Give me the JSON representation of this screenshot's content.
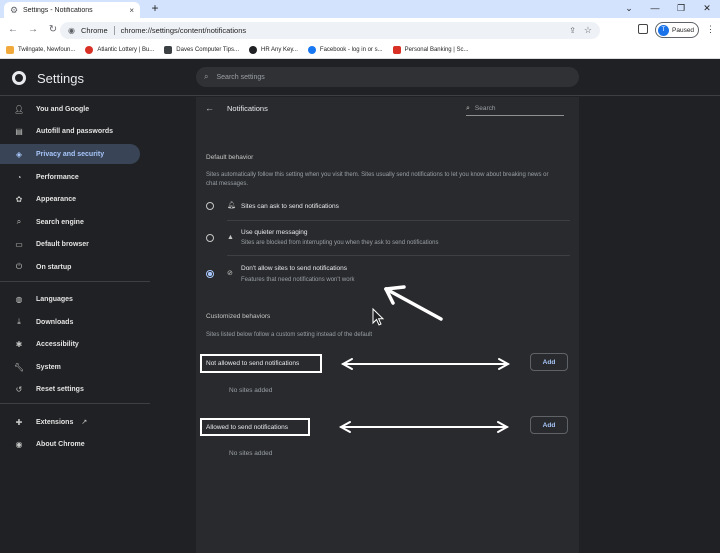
{
  "browser": {
    "tab_title": "Settings - Notifications",
    "tab_close": "×",
    "new_tab": "+",
    "window_controls": [
      "⌄",
      "—",
      "❐",
      "✕"
    ],
    "chrome_label": "Chrome",
    "url": "chrome://settings/content/notifications",
    "profile_initial": "T",
    "profile_status": "Paused",
    "bookmarks": [
      {
        "label": "Twilngate, Newfoun...",
        "color": "#f2a93b"
      },
      {
        "label": "Atlantic Lottery | Bu...",
        "color": "#d93025"
      },
      {
        "label": "Daves Computer Tips...",
        "color": "#3c4043"
      },
      {
        "label": "HR Any Key...",
        "color": "#202124"
      },
      {
        "label": "Facebook - log in or s...",
        "color": "#1877f2"
      },
      {
        "label": "Personal Banking | Sc...",
        "color": "#d93025"
      }
    ]
  },
  "settings": {
    "title": "Settings",
    "search_placeholder": "Search settings"
  },
  "sidebar": {
    "items": [
      {
        "label": "You and Google",
        "icon": "person-icon"
      },
      {
        "label": "Autofill and passwords",
        "icon": "clipboard-icon"
      },
      {
        "label": "Privacy and security",
        "icon": "shield-icon",
        "active": true
      },
      {
        "label": "Performance",
        "icon": "speedometer-icon"
      },
      {
        "label": "Appearance",
        "icon": "palette-icon"
      },
      {
        "label": "Search engine",
        "icon": "search-icon"
      },
      {
        "label": "Default browser",
        "icon": "browser-icon"
      },
      {
        "label": "On startup",
        "icon": "power-icon"
      },
      {
        "label": "Languages",
        "icon": "globe-icon"
      },
      {
        "label": "Downloads",
        "icon": "download-icon"
      },
      {
        "label": "Accessibility",
        "icon": "accessibility-icon"
      },
      {
        "label": "System",
        "icon": "wrench-icon"
      },
      {
        "label": "Reset settings",
        "icon": "reset-icon"
      },
      {
        "label": "Extensions",
        "icon": "puzzle-icon"
      },
      {
        "label": "About Chrome",
        "icon": "chrome-icon"
      }
    ]
  },
  "notifications": {
    "title": "Notifications",
    "search_placeholder": "Search",
    "default_behavior": "Default behavior",
    "default_desc": "Sites automatically follow this setting when you visit them. Sites usually send notifications to let you know about breaking news or chat messages.",
    "options": [
      {
        "title": "Sites can ask to send notifications",
        "sub": "",
        "checked": false,
        "icon": "bell-icon"
      },
      {
        "title": "Use quieter messaging",
        "sub": "Sites are blocked from interrupting you when they ask to send notifications",
        "checked": false,
        "icon": "bell-quiet-icon"
      },
      {
        "title": "Don't allow sites to send notifications",
        "sub": "Features that need notifications won't work",
        "checked": true,
        "icon": "bell-off-icon"
      }
    ],
    "customized": "Customized behaviors",
    "customized_desc": "Sites listed below follow a custom setting instead of the default",
    "not_allowed_label": "Not allowed to send notifications",
    "allowed_label": "Allowed to send notifications",
    "add_label": "Add",
    "no_sites": "No sites added"
  },
  "colors": {
    "accent": "#a8c7fa",
    "active_bg": "#394457",
    "card_bg": "#292a2d",
    "page_bg": "#202124"
  }
}
